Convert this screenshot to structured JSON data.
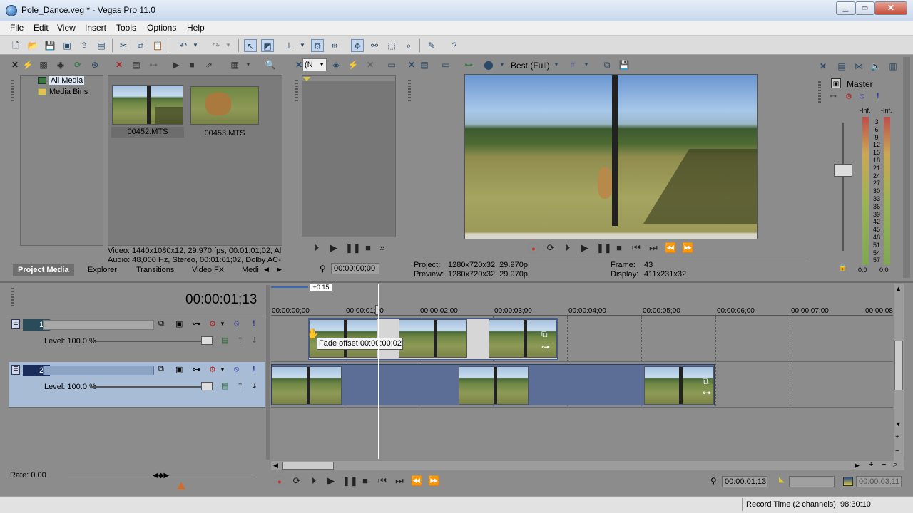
{
  "window": {
    "title": "Pole_Dance.veg * - Vegas Pro 11.0",
    "min": "▁",
    "max": "▭",
    "close": "✕"
  },
  "menu": [
    "File",
    "Edit",
    "View",
    "Insert",
    "Tools",
    "Options",
    "Help"
  ],
  "media": {
    "tree": [
      "All Media",
      "Media Bins"
    ],
    "files": [
      "00452.MTS",
      "00453.MTS"
    ],
    "video_info": "Video: 1440x1080x12, 29.970 fps, 00:01:01;02, Al",
    "audio_info": "Audio: 48,000 Hz, Stereo, 00:01:01;02, Dolby AC-"
  },
  "tabs": [
    "Project Media",
    "Explorer",
    "Transitions",
    "Video FX",
    "Medi"
  ],
  "trimmer": {
    "time": "00:00:00;00",
    "dropdown": "(N"
  },
  "preview": {
    "quality": "Best (Full)",
    "project_label": "Project:",
    "project_value": "1280x720x32, 29.970p",
    "preview_label": "Preview:",
    "preview_value": "1280x720x32, 29.970p",
    "frame_label": "Frame:",
    "frame_value": "43",
    "display_label": "Display:",
    "display_value": "411x231x32"
  },
  "mixer": {
    "label": "Master",
    "left_peak": "-Inf.",
    "right_peak": "-Inf.",
    "left_val": "0.0",
    "right_val": "0.0",
    "scale": [
      "3",
      "6",
      "9",
      "12",
      "15",
      "18",
      "21",
      "24",
      "27",
      "30",
      "33",
      "36",
      "39",
      "42",
      "45",
      "48",
      "51",
      "54",
      "57"
    ]
  },
  "timeline": {
    "timecode": "00:00:01;13",
    "offset": "+0:15",
    "ruler": [
      "00:00:00;00",
      "00:00:01;00",
      "00:00:02;00",
      "00:00:03;00",
      "00:00:04;00",
      "00:00:05;00",
      "00:00:06;00",
      "00:00:07;00",
      "00:00:08"
    ],
    "tracks": [
      {
        "num": "1",
        "level": "Level: 100.0 %"
      },
      {
        "num": "2",
        "level": "Level: 100.0 %"
      }
    ],
    "tooltip": "Fade offset 00:00:00;02",
    "rate": "Rate: 0.00",
    "cursor_time": "00:00:01;13",
    "end_time": "00:00:03;11"
  },
  "status": {
    "record_time": "Record Time (2 channels): 98:30:10"
  }
}
